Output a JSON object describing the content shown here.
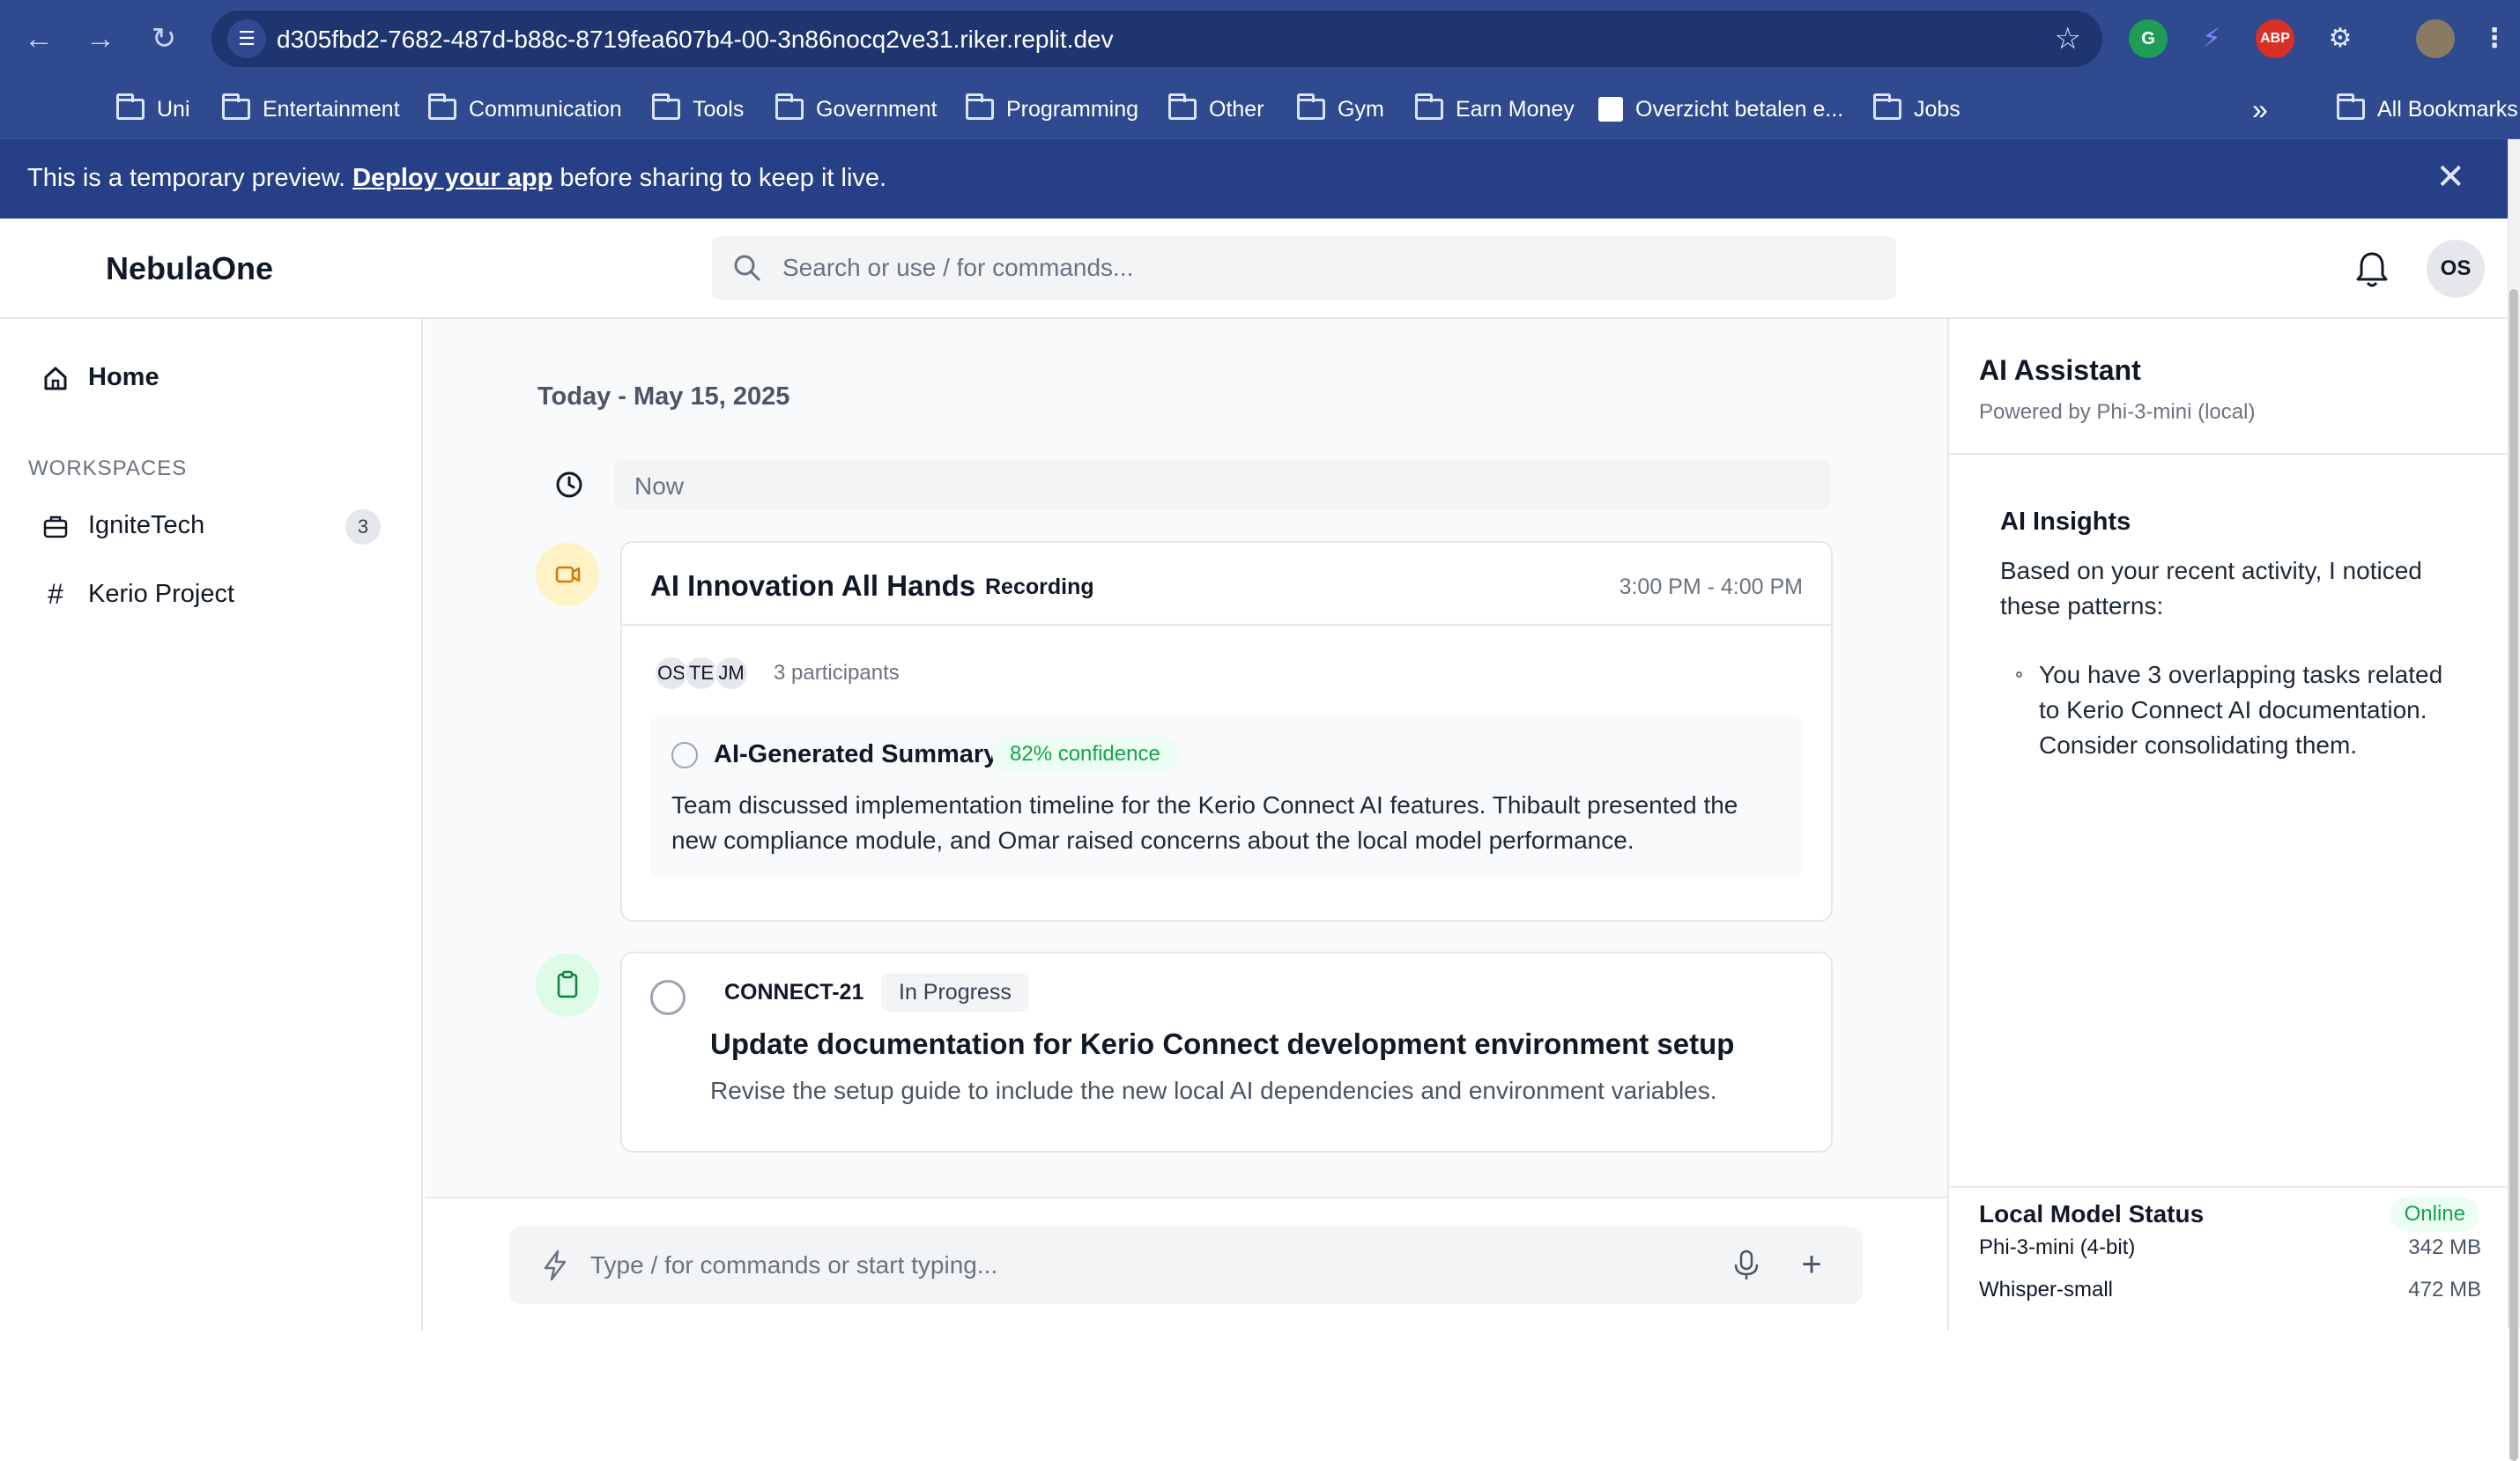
{
  "browser": {
    "url": "d305fbd2-7682-487d-b88c-8719fea607b4-00-3n86nocq2ve31.riker.replit.dev",
    "extension_abp": "ABP",
    "bookmarks": [
      "Uni",
      "Entertainment",
      "Communication",
      "Tools",
      "Government",
      "Programming",
      "Other",
      "Gym",
      "Earn Money",
      "Overzicht betalen e...",
      "Jobs"
    ],
    "all_bookmarks": "All Bookmarks"
  },
  "banner": {
    "text_before": "This is a temporary preview. ",
    "link": "Deploy your app",
    "text_after": " before sharing to keep it live."
  },
  "header": {
    "brand": "NebulaOne",
    "search_placeholder": "Search or use / for commands...",
    "avatar_initials": "OS"
  },
  "sidebar": {
    "home": "Home",
    "section": "WORKSPACES",
    "items": [
      {
        "label": "IgniteTech",
        "badge": "3",
        "icon": "briefcase-icon"
      },
      {
        "label": "Kerio Project",
        "icon": "hash-icon"
      }
    ]
  },
  "feed": {
    "date": "Today - May 15, 2025",
    "now": "Now",
    "meeting": {
      "title": "AI Innovation All Hands",
      "status": "Recording",
      "time": "3:00 PM - 4:00 PM",
      "participants": [
        "OS",
        "TE",
        "JM"
      ],
      "participants_label": "3 participants",
      "summary_title": "AI-Generated Summary",
      "confidence": "82% confidence",
      "summary": "Team discussed implementation timeline for the Kerio Connect AI features. Thibault presented the new compliance module, and Omar raised concerns about the local model performance."
    },
    "task": {
      "id": "CONNECT-21",
      "status": "In Progress",
      "title": "Update documentation for Kerio Connect development environment setup",
      "description": "Revise the setup guide to include the new local AI dependencies and environment variables."
    }
  },
  "composer": {
    "placeholder": "Type / for commands or start typing..."
  },
  "assistant": {
    "title": "AI Assistant",
    "subtitle": "Powered by Phi-3-mini (local)",
    "insights_title": "AI Insights",
    "insights_intro": "Based on your recent activity, I noticed these patterns:",
    "insight": "You have 3 overlapping tasks related to Kerio Connect AI documentation. Consider consolidating them.",
    "model_status_title": "Local Model Status",
    "model_status": "Online",
    "models": [
      {
        "name": "Phi-3-mini (4-bit)",
        "size": "342 MB"
      },
      {
        "name": "Whisper-small",
        "size": "472 MB"
      }
    ]
  },
  "colors": {
    "chrome": "#2f4a8f",
    "banner": "#263f86",
    "success": "#16a34a",
    "meeting_dot": "#fef3c7",
    "task_dot": "#dcfce7"
  }
}
